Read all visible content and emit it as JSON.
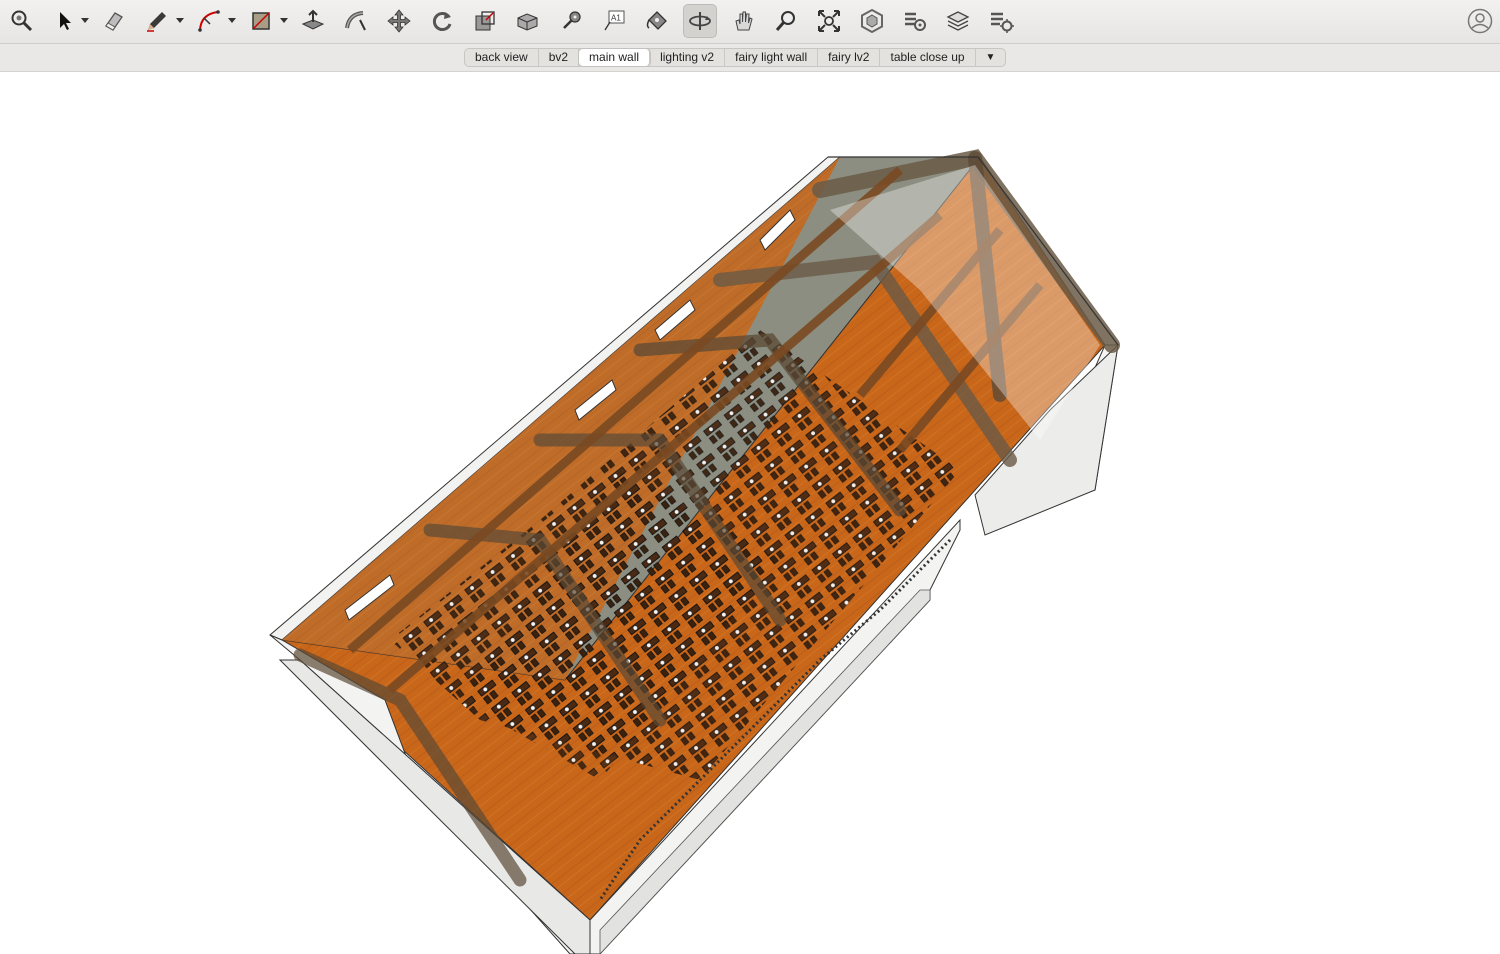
{
  "toolbar": {
    "tools": [
      {
        "name": "zoom-extents-icon",
        "active": false
      },
      {
        "name": "select-icon",
        "active": false
      },
      {
        "name": "eraser-icon",
        "active": false
      },
      {
        "name": "pencil-icon",
        "active": false
      },
      {
        "name": "arc-icon",
        "active": false
      },
      {
        "name": "rectangle-icon",
        "active": false
      },
      {
        "name": "push-pull-icon",
        "active": false
      },
      {
        "name": "follow-me-icon",
        "active": false
      },
      {
        "name": "move-icon",
        "active": false
      },
      {
        "name": "rotate-icon",
        "active": false
      },
      {
        "name": "scale-icon",
        "active": false
      },
      {
        "name": "offset-icon",
        "active": false
      },
      {
        "name": "tape-measure-icon",
        "active": false
      },
      {
        "name": "text-icon",
        "active": false
      },
      {
        "name": "paint-bucket-icon",
        "active": false
      },
      {
        "name": "orbit-icon",
        "active": true
      },
      {
        "name": "pan-icon",
        "active": false
      },
      {
        "name": "zoom-icon",
        "active": false
      },
      {
        "name": "zoom-window-icon",
        "active": false
      },
      {
        "name": "3d-warehouse-icon",
        "active": false
      },
      {
        "name": "extension-warehouse-icon",
        "active": false
      },
      {
        "name": "layers-icon",
        "active": false
      },
      {
        "name": "layer-manager-icon",
        "active": false
      }
    ],
    "text_tool_label": "A1"
  },
  "scenes": {
    "tabs": [
      "back view",
      "bv2",
      "main wall",
      "lighting v2",
      "fairy light wall",
      "fairy lv2",
      "table close up"
    ],
    "selected": "main wall",
    "more_label": "▼"
  },
  "colors": {
    "floor": "#c8661a",
    "beam": "#5a3a20",
    "wall": "#f2f2f0",
    "glass": "#7e8172"
  }
}
